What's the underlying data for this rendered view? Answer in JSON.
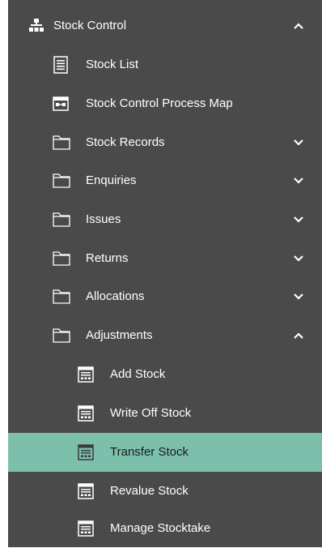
{
  "menu": {
    "root": {
      "label": "Stock Control",
      "icon": "hierarchy-icon",
      "expanded": true
    },
    "items": [
      {
        "label": "Stock List",
        "icon": "list-document-icon"
      },
      {
        "label": "Stock Control Process Map",
        "icon": "process-map-icon"
      },
      {
        "label": "Stock Records",
        "icon": "folder-icon",
        "expanded": false
      },
      {
        "label": "Enquiries",
        "icon": "folder-icon",
        "expanded": false
      },
      {
        "label": "Issues",
        "icon": "folder-icon",
        "expanded": false
      },
      {
        "label": "Returns",
        "icon": "folder-icon",
        "expanded": false
      },
      {
        "label": "Allocations",
        "icon": "folder-icon",
        "expanded": false
      },
      {
        "label": "Adjustments",
        "icon": "folder-icon",
        "expanded": true
      }
    ],
    "sub_items": [
      {
        "label": "Add Stock",
        "icon": "form-icon",
        "selected": false
      },
      {
        "label": "Write Off Stock",
        "icon": "form-icon",
        "selected": false
      },
      {
        "label": "Transfer Stock",
        "icon": "form-icon",
        "selected": true
      },
      {
        "label": "Revalue Stock",
        "icon": "form-icon",
        "selected": false
      },
      {
        "label": "Manage Stocktake",
        "icon": "form-icon",
        "selected": false
      }
    ]
  },
  "colors": {
    "panel_bg": "#4a4a4a",
    "selected_bg": "#7cc0ac",
    "text": "#ffffff"
  }
}
